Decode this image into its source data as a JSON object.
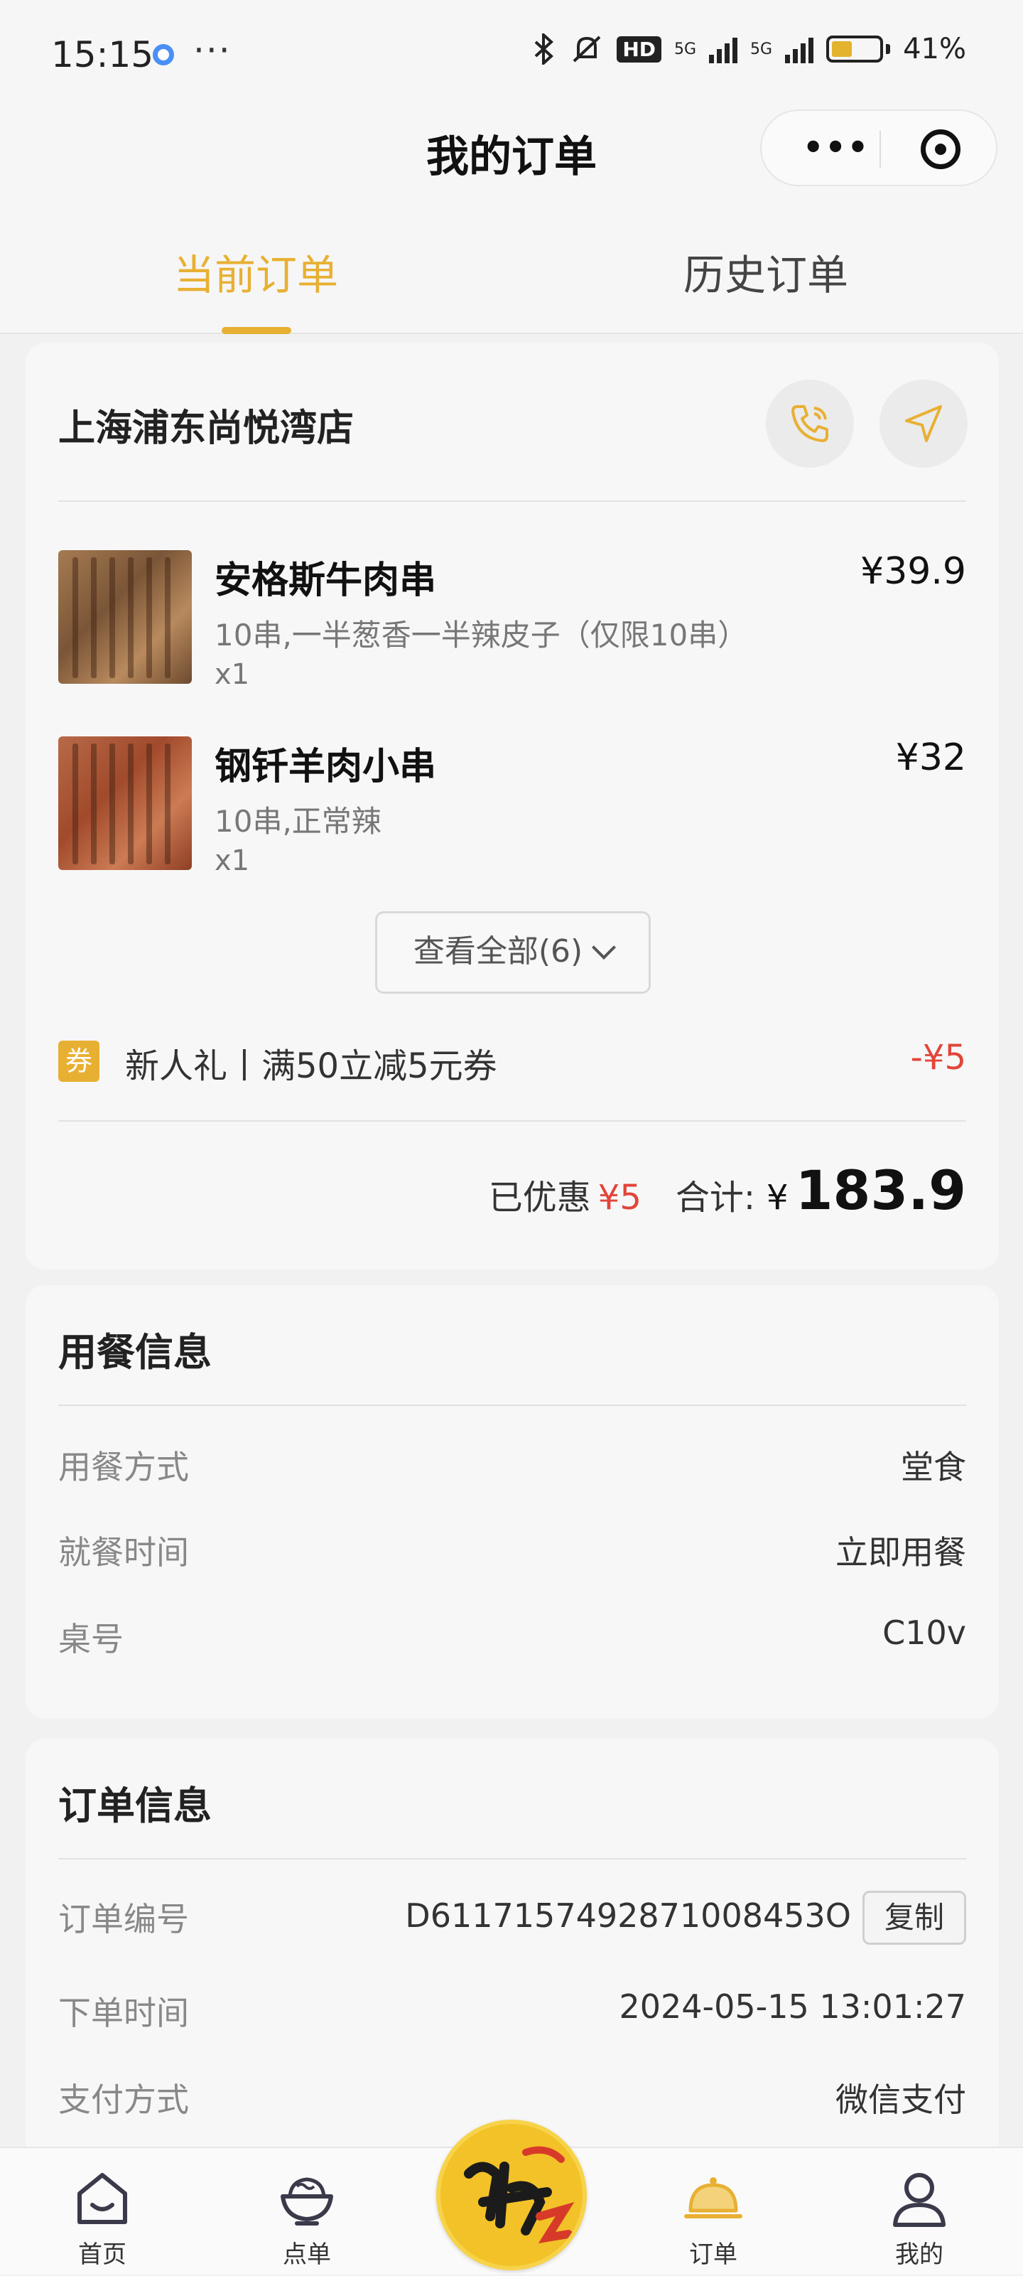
{
  "status_bar": {
    "time": "15:15",
    "more": "···",
    "hd": "HD",
    "net1": "5G",
    "net2": "5G",
    "battery": "41%"
  },
  "header": {
    "title": "我的订单"
  },
  "tabs": [
    {
      "label": "当前订单",
      "active": true
    },
    {
      "label": "历史订单",
      "active": false
    }
  ],
  "order": {
    "store_name": "上海浦东尚悦湾店",
    "items": [
      {
        "name": "安格斯牛肉串",
        "spec": "10串,一半葱香一半辣皮子（仅限10串）",
        "qty": "x1",
        "price": "¥39.9"
      },
      {
        "name": "钢钎羊肉小串",
        "spec": "10串,正常辣",
        "qty": "x1",
        "price": "¥32"
      }
    ],
    "view_all": "查看全部(6)",
    "coupon": {
      "badge": "券",
      "text": "新人礼丨满50立减5元券",
      "amount": "-¥5"
    },
    "summary": {
      "discount_label": "已优惠",
      "discount_value": "¥5",
      "total_label": "合计:",
      "currency": "¥",
      "total": "183.9"
    }
  },
  "dining_info": {
    "title": "用餐信息",
    "rows": [
      {
        "label": "用餐方式",
        "value": "堂食"
      },
      {
        "label": "就餐时间",
        "value": "立即用餐"
      },
      {
        "label": "桌号",
        "value": "C10v"
      }
    ]
  },
  "order_info": {
    "title": "订单信息",
    "rows": [
      {
        "label": "订单编号",
        "value": "D6117157492871008453O"
      },
      {
        "label": "下单时间",
        "value": "2024-05-15 13:01:27"
      },
      {
        "label": "支付方式",
        "value": "微信支付"
      }
    ],
    "copy_label": "复制"
  },
  "bottom_nav": [
    {
      "label": "首页",
      "icon": "home-icon"
    },
    {
      "label": "点单",
      "icon": "bowl-icon"
    },
    {
      "label": "订单",
      "icon": "cloche-icon",
      "active": true
    },
    {
      "label": "我的",
      "icon": "person-icon"
    }
  ],
  "colors": {
    "accent": "#e8b033",
    "discount_red": "#e2453a",
    "background": "#f1f1f1"
  }
}
